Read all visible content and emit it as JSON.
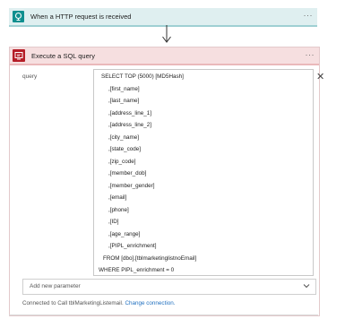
{
  "trigger": {
    "title": "When a HTTP request is received",
    "more": "···",
    "icon": "http-request-icon",
    "accent": "#0f8f8f"
  },
  "action": {
    "title": "Execute a SQL query",
    "more": "···",
    "icon": "sql-server-icon",
    "accent": "#b51d27",
    "query_label": "query",
    "query_lines": [
      "SELECT TOP (5000) [MD5Hash]",
      ",[first_name]",
      ",[last_name]",
      ",[address_line_1]",
      ",[address_line_2]",
      ",[city_name]",
      ",[state_code]",
      ",[zip_code]",
      ",[member_dob]",
      ",[member_gender]",
      ",[email]",
      ",[phone]",
      ",[ID]",
      ",[age_range]",
      ",[PIPL_enrichment]",
      "FROM [dbo].[tblmarketinglistnoEmail]",
      "WHERE PIPL_enrichment = 0"
    ],
    "clear_icon": "close-icon",
    "add_param_label": "Add new parameter",
    "connected_text": "Connected to Call tblMarketingListemail.",
    "change_connection": "Change connection."
  }
}
